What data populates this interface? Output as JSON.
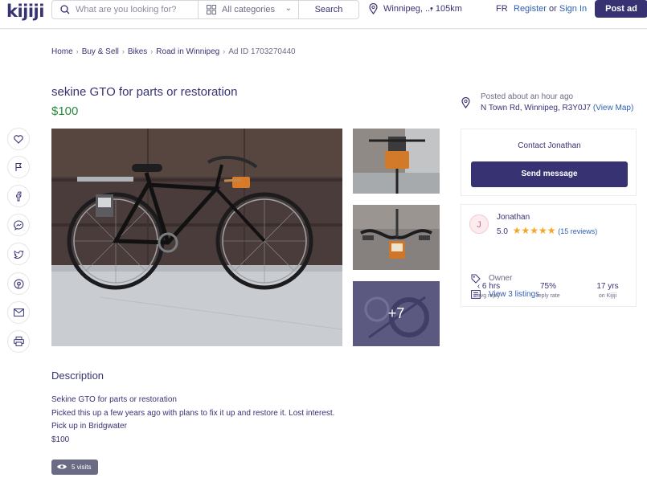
{
  "header": {
    "logo": "kijiji",
    "search_placeholder": "What are you looking for?",
    "category": "All categories",
    "search_button": "Search",
    "location": "Winnipeg, ...",
    "radius": "• 105km",
    "lang": "FR",
    "register": "Register",
    "or": "or",
    "sign_in": "Sign In",
    "post_ad": "Post ad"
  },
  "breadcrumb": [
    "Home",
    "Buy & Sell",
    "Bikes",
    "Road in Winnipeg",
    "Ad ID 1703270440"
  ],
  "listing": {
    "title": "sekine GTO for parts or restoration",
    "price": "$100",
    "posted": "Posted about an hour ago",
    "address": "N Town Rd, Winnipeg, R3Y0J7",
    "view_map": "(View Map)",
    "thumb_more": "+7"
  },
  "contact": {
    "title": "Contact Jonathan",
    "send_button": "Send message"
  },
  "seller": {
    "initial": "J",
    "name": "Jonathan",
    "rating": "5.0",
    "stars": "★★★★★",
    "reviews": "(15 reviews)",
    "role": "Owner",
    "listings": "View 3 listings",
    "stats": [
      {
        "value": "‹ 6 hrs",
        "label": "avg reply"
      },
      {
        "value": "75%",
        "label": "reply rate"
      },
      {
        "value": "17 yrs",
        "label": "on Kijiji"
      }
    ]
  },
  "description": {
    "heading": "Description",
    "lines": [
      "Sekine GTO for parts or restoration",
      "Picked this up a few years ago with plans to fix it up and restore it. Lost interest.",
      "Pick up in Bridgwater",
      "$100"
    ],
    "visits": "5 visits"
  },
  "colors": {
    "brand": "#373373",
    "price": "#2b8a3e",
    "link": "#2f5fb3",
    "star": "#f6a623"
  },
  "share_icons": [
    "heart-icon",
    "flag-icon",
    "facebook-icon",
    "messenger-icon",
    "twitter-icon",
    "pinterest-icon",
    "email-icon",
    "print-icon"
  ]
}
